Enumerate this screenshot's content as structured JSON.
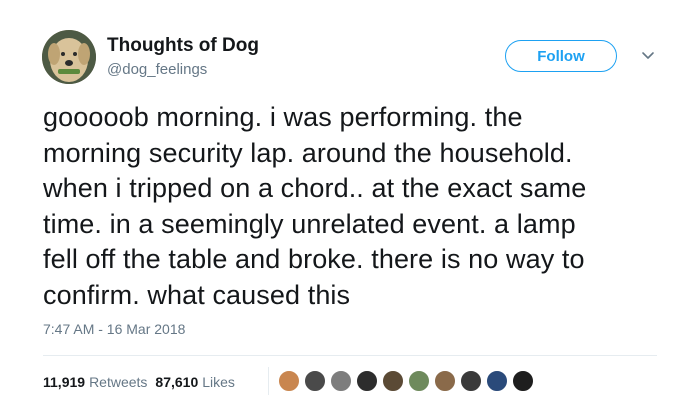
{
  "author": {
    "display_name": "Thoughts of Dog",
    "handle": "@dog_feelings",
    "avatar_icon": "dog-avatar"
  },
  "follow_button": {
    "label": "Follow",
    "color": "#1da1f2"
  },
  "menu_icon": "chevron-down-icon",
  "tweet": {
    "text": "gooooob morning. i was performing. the\nmorning security lap. around the household.\nwhen i tripped on a chord.. at the exact same\ntime. in a seemingly unrelated event. a lamp\nfell off the table and broke. there is no way to\nconfirm. what caused this",
    "timestamp": "7:47 AM - 16 Mar 2018"
  },
  "stats": {
    "retweets": {
      "count": "11,919",
      "label": "Retweets"
    },
    "likes": {
      "count": "87,610",
      "label": "Likes"
    }
  },
  "liker_avatars": [
    {
      "color": "#c9864f"
    },
    {
      "color": "#4a4a4a"
    },
    {
      "color": "#7d7d7d"
    },
    {
      "color": "#2d2d2d"
    },
    {
      "color": "#5b4a35"
    },
    {
      "color": "#6e8a5c"
    },
    {
      "color": "#8a6a4a"
    },
    {
      "color": "#3a3a3a"
    },
    {
      "color": "#2a4a7a"
    },
    {
      "color": "#1e1e1e"
    }
  ]
}
